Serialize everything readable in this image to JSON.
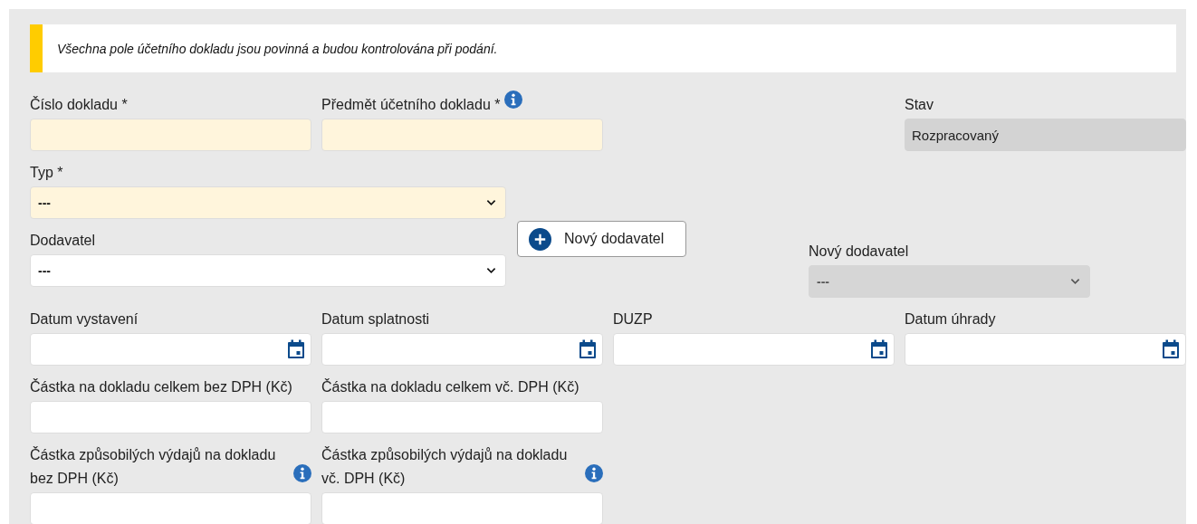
{
  "notice": {
    "text": "Všechna pole účetního dokladu jsou povinná a budou kontrolována při podání."
  },
  "rows": [
    {
      "fields": [
        {
          "kind": "text",
          "label": "Číslo dokladu *",
          "required": true
        },
        {
          "kind": "text",
          "label": "Předmět účetního dokladu *",
          "required": true,
          "info": true
        },
        {
          "kind": "readonly",
          "label": "Stav",
          "value": "Rozpracovaný"
        }
      ]
    },
    {
      "fields": [
        {
          "kind": "select",
          "label": "Typ *",
          "value": "---",
          "required": true,
          "disabled": false
        }
      ]
    },
    {
      "fields": [
        {
          "kind": "select",
          "label": "Dodavatel",
          "value": "---",
          "required": false,
          "disabled": false
        },
        {
          "kind": "button",
          "label": "Nový dodavatel"
        },
        {
          "kind": "select",
          "label": "Nový dodavatel",
          "value": "---",
          "required": false,
          "disabled": true
        }
      ]
    },
    {
      "fields": [
        {
          "kind": "date",
          "label": "Datum vystavení",
          "required": false
        },
        {
          "kind": "date",
          "label": "Datum splatnosti",
          "required": false
        },
        {
          "kind": "date",
          "label": "DUZP",
          "required": false
        },
        {
          "kind": "date",
          "label": "Datum úhrady",
          "required": false
        }
      ]
    },
    {
      "fields": [
        {
          "kind": "text",
          "label": "Částka na dokladu celkem bez DPH (Kč)",
          "required": false
        },
        {
          "kind": "text",
          "label": "Částka na dokladu celkem vč. DPH (Kč)",
          "required": false
        }
      ]
    },
    {
      "fields": [
        {
          "kind": "text",
          "label": "Částka způsobilých výdajů na dokladu bez DPH (Kč)",
          "required": false,
          "info": true
        },
        {
          "kind": "text",
          "label": "Částka způsobilých výdajů na dokladu vč. DPH (Kč)",
          "required": false,
          "info": true
        }
      ]
    }
  ]
}
